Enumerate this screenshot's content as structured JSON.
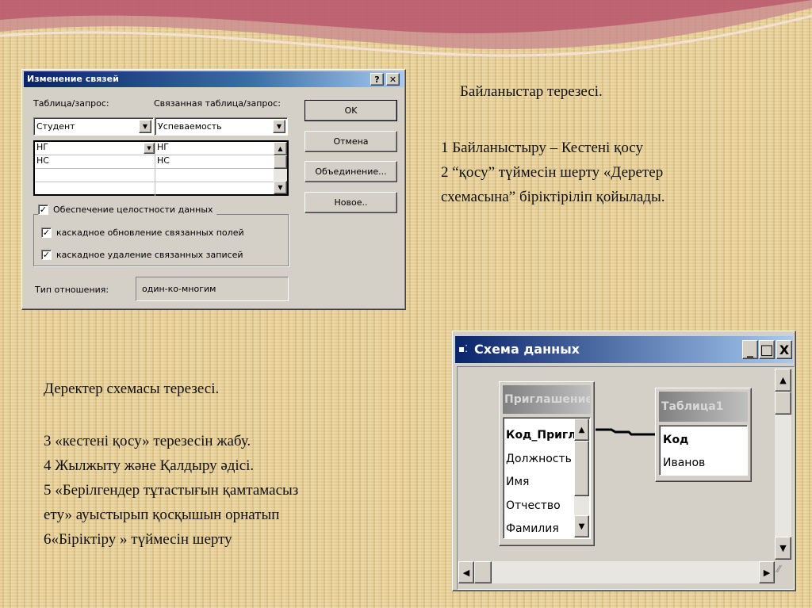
{
  "dialog": {
    "title": "Изменение связей",
    "help": "?",
    "close": "✕",
    "table_label": "Таблица/запрос:",
    "related_label": "Связанная таблица/запрос:",
    "table_value": "Студент",
    "related_value": "Успеваемость",
    "rows": [
      [
        "НГ",
        "НГ"
      ],
      [
        "НС",
        "НС"
      ],
      [
        "",
        ""
      ],
      [
        "",
        ""
      ]
    ],
    "integrity": "Обеспечение целостности данных",
    "cascade_update": "каскадное обновление связанных полей",
    "cascade_delete": "каскадное удаление связанных записей",
    "relation_label": "Тип отношения:",
    "relation_value": "один-ко-многим",
    "buttons": {
      "ok": "OK",
      "cancel": "Отмена",
      "join": "Объединение...",
      "new": "Новое.."
    }
  },
  "text1": {
    "title": "Байланыстар терезесі.",
    "line1": "1 Байланыстыру – Кестені қосу",
    "line2": "2 “қосу” түймесін шерту  «Деретер",
    "line3": "схемасына” біріктіріліп қойылады."
  },
  "text2": {
    "title": "Деректер схемасы терезесі.",
    "line1": "3 «кестені қосу» терезесін жабу.",
    "line2": "4 Жылжыту және Қалдыру әдісі.",
    "line3": "5 «Берілгендер тұтастығын қамтамасыз",
    "line4": "ету» ауыстырып қосқышын орнатып",
    "line5": "6«Біріктіру » түймесін шерту"
  },
  "schema": {
    "title": "Схема данных",
    "minimize": "_",
    "maximize": "□",
    "close": "X",
    "table1": {
      "title": "Приглашение...",
      "fields": [
        "Код_Приглаш",
        "Должность",
        "Имя",
        "Отчество",
        "Фамилия"
      ]
    },
    "table2": {
      "title": "Таблица1",
      "fields": [
        "Код",
        "Иванов"
      ]
    }
  }
}
